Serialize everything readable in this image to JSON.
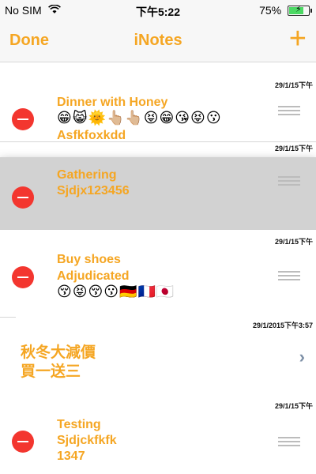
{
  "status_bar": {
    "carrier": "No SIM",
    "wifi_icon": "wifi-icon",
    "time": "下午5:22",
    "battery": "75%",
    "battery_level": 0.75
  },
  "nav": {
    "done": "Done",
    "title": "iNotes",
    "add": "+"
  },
  "notes": [
    {
      "date": "29/1/15下午",
      "lines": [
        "Dinner with Honey",
        "😁😸🌞👆🏼👆🏼😝😁😘😝😗",
        "Asfkfoxkdd"
      ]
    },
    {
      "date": "29/1/15下午",
      "lines": [
        "Gathering",
        "Sjdjx123456"
      ]
    },
    {
      "date": "29/1/15下午",
      "lines": [
        "Buy shoes",
        "Adjudicated",
        "😚😝😚😗🇩🇪🇫🇷🇯🇵"
      ]
    },
    {
      "date": "29/1/2015下午3:57",
      "lines": [
        "秋冬大減價",
        "買一送三"
      ]
    },
    {
      "date": "29/1/15下午",
      "lines": [
        "Testing",
        "Sjdjckfkfk",
        "1347"
      ]
    }
  ]
}
